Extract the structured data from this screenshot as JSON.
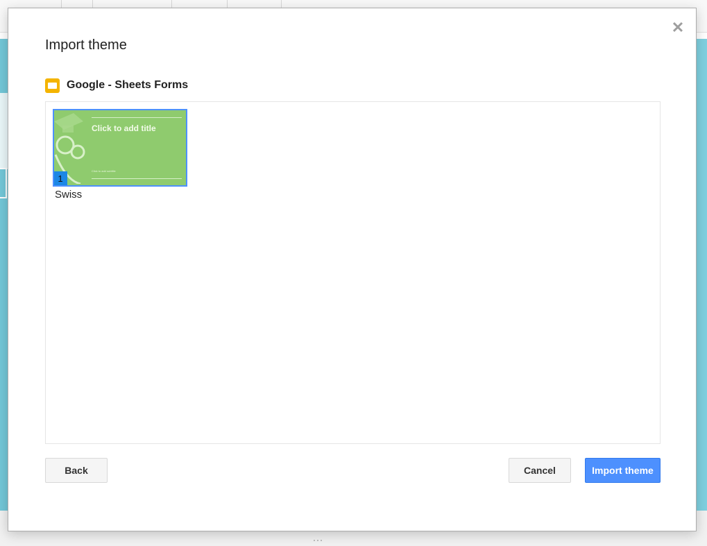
{
  "dialog": {
    "title": "Import theme",
    "close_icon": "close-icon",
    "source": {
      "icon": "google-slides-icon",
      "name": "Google - Sheets Forms"
    },
    "themes": [
      {
        "slide_number": "1",
        "thumbnail_title": "Click to add title",
        "thumbnail_subtitle": "Click to add subtitle",
        "name": "Swiss",
        "selected": true
      }
    ],
    "buttons": {
      "back": "Back",
      "cancel": "Cancel",
      "import": "Import theme"
    }
  },
  "colors": {
    "primary_button": "#4d90fe",
    "selection_border": "#4d90fe",
    "thumbnail_background": "#8fcb6e",
    "slides_icon": "#f4b400",
    "background_canvas": "#7fd0e0"
  }
}
